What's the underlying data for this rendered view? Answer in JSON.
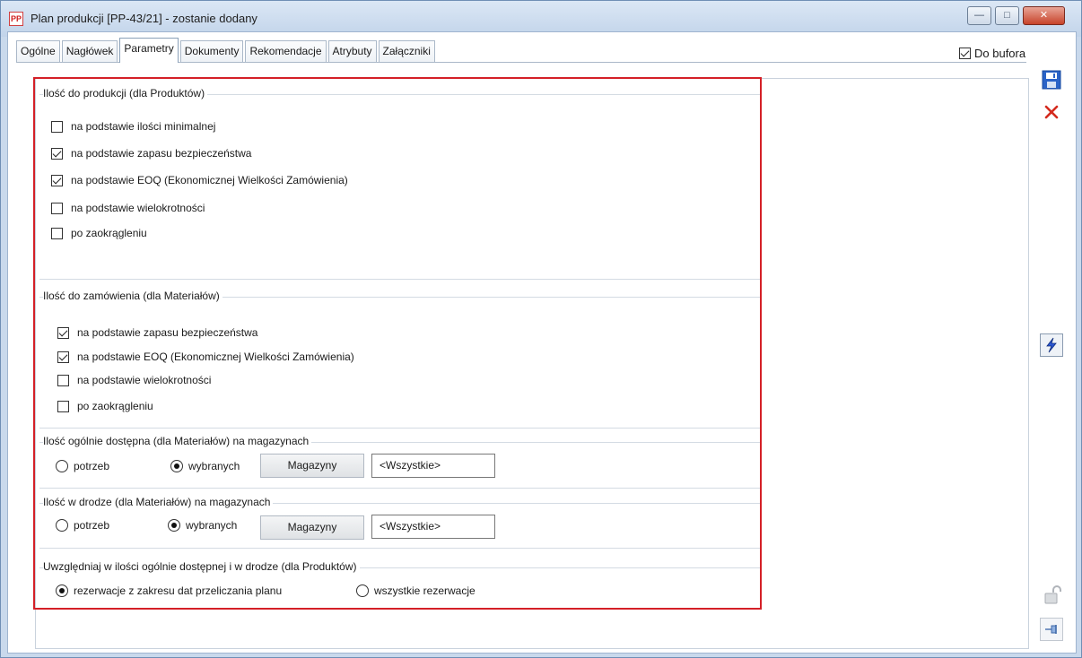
{
  "window": {
    "title": "Plan produkcji [PP-43/21] - zostanie dodany",
    "icon_label": "PP",
    "controls": {
      "minimize": "—",
      "maximize": "□",
      "close": "✕"
    }
  },
  "tabs": [
    {
      "label": "Ogólne"
    },
    {
      "label": "Nagłówek"
    },
    {
      "label": "Parametry"
    },
    {
      "label": "Dokumenty"
    },
    {
      "label": "Rekomendacje"
    },
    {
      "label": "Atrybuty"
    },
    {
      "label": "Załączniki"
    }
  ],
  "active_tab": "Parametry",
  "do_bufora": {
    "label": "Do bufora",
    "checked": true
  },
  "production": {
    "title": "Ilość do produkcji (dla Produktów)",
    "options": [
      {
        "label": "na podstawie ilości minimalnej",
        "checked": false
      },
      {
        "label": "na podstawie zapasu bezpieczeństwa",
        "checked": true
      },
      {
        "label": "na podstawie EOQ (Ekonomicznej Wielkości Zamówienia)",
        "checked": true
      },
      {
        "label": "na podstawie wielokrotności",
        "checked": false
      },
      {
        "label": "po zaokrągleniu",
        "checked": false
      }
    ]
  },
  "order": {
    "title": "Ilość do zamówienia (dla Materiałów)",
    "options": [
      {
        "label": "na podstawie zapasu bezpieczeństwa",
        "checked": true
      },
      {
        "label": "na podstawie EOQ (Ekonomicznej Wielkości Zamówienia)",
        "checked": true
      },
      {
        "label": "na podstawie wielokrotności",
        "checked": false
      },
      {
        "label": "po zaokrągleniu",
        "checked": false
      }
    ]
  },
  "available": {
    "title": "Ilość ogólnie dostępna (dla Materiałów) na magazynach",
    "radio_potrzeb": "potrzeb",
    "radio_wybranych": "wybranych",
    "selected": "wybranych",
    "button": "Magazyny",
    "value": "<Wszystkie>"
  },
  "transit": {
    "title": "Ilość w drodze (dla Materiałów) na magazynach",
    "radio_potrzeb": "potrzeb",
    "radio_wybranych": "wybranych",
    "selected": "wybranych",
    "button": "Magazyny",
    "value": "<Wszystkie>"
  },
  "reservations": {
    "title": "Uwzględniaj w ilości ogólnie dostępnej i w drodze (dla Produktów)",
    "radio_range": "rezerwacje z zakresu dat przeliczania planu",
    "radio_all": "wszystkie rezerwacje",
    "selected": "range"
  },
  "side_icons": [
    "save-icon",
    "cancel-icon",
    "lightning-icon",
    "lock-icon",
    "pin-icon"
  ],
  "colors": {
    "highlight": "#d42027",
    "accent": "#2a63c7"
  }
}
